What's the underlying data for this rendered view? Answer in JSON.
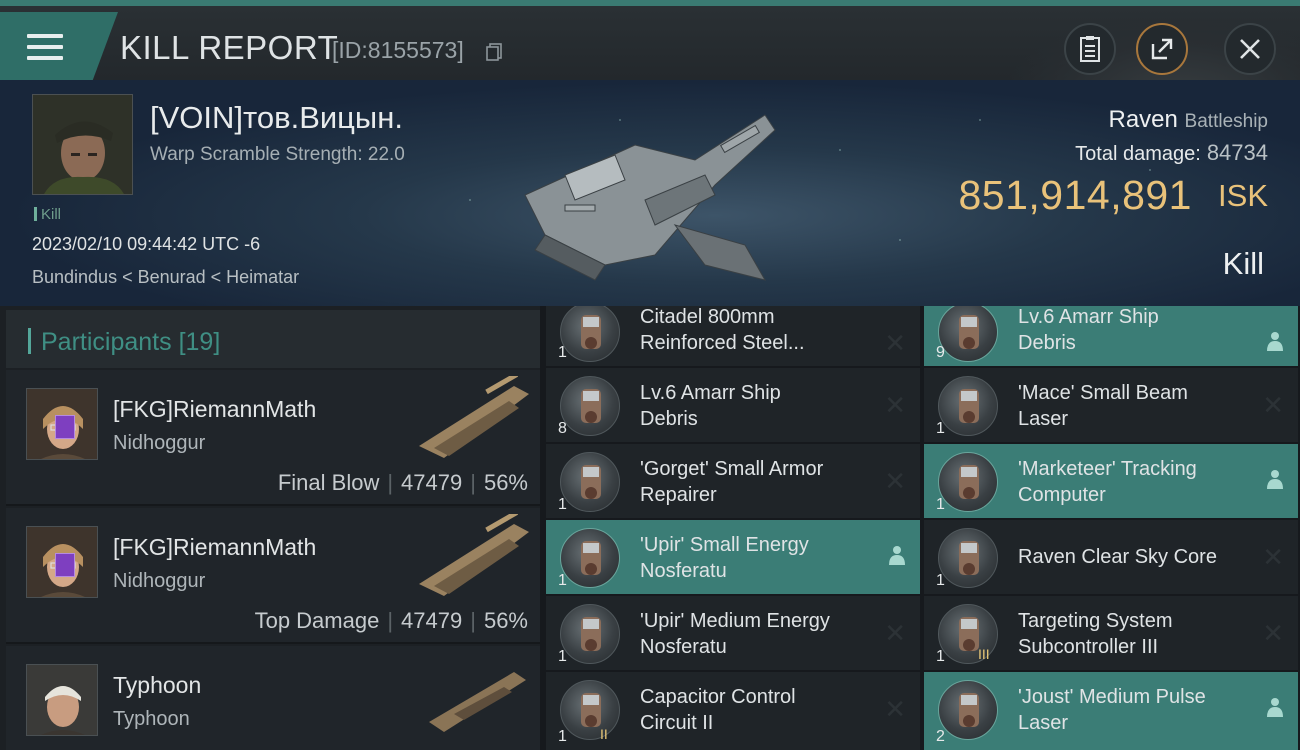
{
  "header": {
    "title": "KILL REPORT",
    "report_id": "[ID:8155573]",
    "icons": [
      "menu-icon",
      "copy-icon",
      "clipboard-icon",
      "share-icon",
      "close-icon"
    ]
  },
  "victim": {
    "name": "[VOIN]тов.Вицын.",
    "subtitle": "Warp Scramble Strength: 22.0",
    "tag": "Kill",
    "datetime": "2023/02/10 09:44:42 UTC -6",
    "location": "Bundindus < Benurad < Heimatar",
    "ship": "Raven",
    "ship_class": "Battleship",
    "total_damage_label": "Total damage:",
    "total_damage": "84734",
    "isk_value": "851,914,891",
    "isk_unit": "ISK",
    "result": "Kill"
  },
  "participants": {
    "label": "Participants",
    "count": "[19]",
    "rows": [
      {
        "name": "[FKG]RiemannMath",
        "ship": "Nidhoggur",
        "role": "Final Blow",
        "damage": "47479",
        "percent": "56%"
      },
      {
        "name": "[FKG]RiemannMath",
        "ship": "Nidhoggur",
        "role": "Top Damage",
        "damage": "47479",
        "percent": "56%"
      },
      {
        "name": "Typhoon",
        "ship": "Typhoon",
        "role": "",
        "damage": "",
        "percent": ""
      }
    ]
  },
  "items_left": [
    {
      "qty": "1",
      "name": "Citadel 800mm\nReinforced Steel...",
      "highlight": false
    },
    {
      "qty": "8",
      "name": "Lv.6 Amarr Ship\nDebris",
      "highlight": false
    },
    {
      "qty": "1",
      "name": "'Gorget' Small Armor\nRepairer",
      "highlight": false
    },
    {
      "qty": "1",
      "name": "'Upir' Small Energy\nNosferatu",
      "highlight": true
    },
    {
      "qty": "1",
      "name": "'Upir' Medium Energy\nNosferatu",
      "highlight": false
    },
    {
      "qty": "1",
      "meta": "II",
      "name": "Capacitor Control\nCircuit II",
      "highlight": false
    }
  ],
  "items_right": [
    {
      "qty": "9",
      "name": "Lv.6 Amarr Ship\nDebris",
      "highlight": true
    },
    {
      "qty": "1",
      "name": "'Mace' Small Beam\nLaser",
      "highlight": false
    },
    {
      "qty": "1",
      "name": "'Marketeer' Tracking\nComputer",
      "highlight": true
    },
    {
      "qty": "1",
      "name": "Raven Clear Sky Core",
      "highlight": false
    },
    {
      "qty": "1",
      "meta": "III",
      "name": "Targeting System\nSubcontroller III",
      "highlight": false
    },
    {
      "qty": "2",
      "name": "'Joust' Medium Pulse\nLaser",
      "highlight": true
    }
  ],
  "colors": {
    "accent": "#3b7d76",
    "isk": "#e9c27a",
    "participants_label": "#3f8f84"
  }
}
